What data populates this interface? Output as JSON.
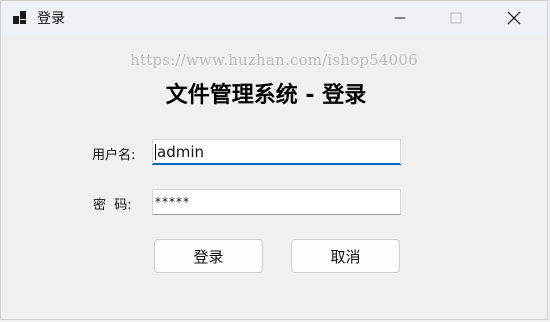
{
  "window": {
    "title": "登录",
    "controls": [
      "minimize-icon",
      "maximize-icon",
      "close-icon"
    ]
  },
  "watermark": "https://www.huzhan.com/ishop54006",
  "form": {
    "heading": "文件管理系统 - 登录",
    "username_label": "用户名:",
    "username_value": "admin",
    "password_label": "密  码:",
    "password_value": "*****",
    "login_button": "登录",
    "cancel_button": "取消"
  },
  "colors": {
    "focus_accent": "#0a67c4",
    "titlebar_bg": "#eef2f7",
    "window_bg": "#f0f0f0"
  }
}
